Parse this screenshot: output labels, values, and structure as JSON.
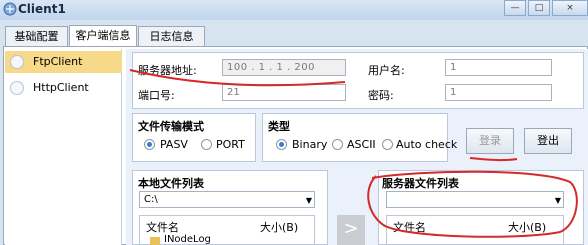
{
  "window": {
    "title": "Client1",
    "min": "—",
    "max": "□",
    "close": "×"
  },
  "tabs": [
    {
      "label": "基础配置"
    },
    {
      "label": "客户端信息"
    },
    {
      "label": "日志信息"
    }
  ],
  "client_list": [
    {
      "label": "FtpClient",
      "selected": true
    },
    {
      "label": "HttpClient",
      "selected": false
    }
  ],
  "server": {
    "addr_label": "服务器地址:",
    "addr_value": "100 . 1 . 1 . 200",
    "user_label": "用户名:",
    "user_value": "1",
    "port_label": "端口号:",
    "port_value": "21",
    "pwd_label": "密码:",
    "pwd_value": "1"
  },
  "transfer_mode": {
    "title": "文件传输模式",
    "options": [
      {
        "label": "PASV",
        "checked": true
      },
      {
        "label": "PORT",
        "checked": false
      }
    ]
  },
  "type": {
    "title": "类型",
    "options": [
      {
        "label": "Binary",
        "checked": true
      },
      {
        "label": "ASCII",
        "checked": false
      },
      {
        "label": "Auto check",
        "checked": false
      }
    ]
  },
  "buttons": {
    "login": "登录",
    "logout": "登出",
    "transfer": ">"
  },
  "local_files": {
    "title": "本地文件列表",
    "path": "C:\\",
    "col_name": "文件名",
    "col_size": "大小(B)",
    "first_item": "INodeLog"
  },
  "server_files": {
    "title": "服务器文件列表",
    "path": "",
    "col_name": "文件名",
    "col_size": "大小(B)"
  },
  "colors": {
    "annotation": "#d42a2a",
    "selected": "#f7d98a",
    "accent": "#2e7dd6"
  }
}
